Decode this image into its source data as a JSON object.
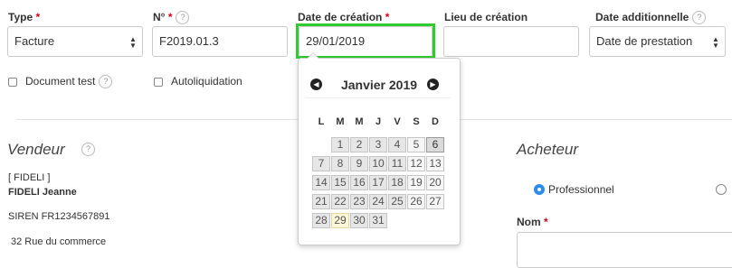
{
  "form": {
    "type": {
      "label": "Type",
      "required": "*",
      "value": "Facture"
    },
    "numero": {
      "label": "N°",
      "required": "*",
      "value": "F2019.01.3"
    },
    "date_creation": {
      "label": "Date de création",
      "required": "*",
      "value": "29/01/2019"
    },
    "lieu_creation": {
      "label": "Lieu de création",
      "value": ""
    },
    "date_additionnelle": {
      "label": "Date additionnelle",
      "value": "Date de prestation"
    },
    "document_test": {
      "label": "Document test",
      "checked": false
    },
    "autoliquidation": {
      "label": "Autoliquidation",
      "checked": false
    },
    "help_icon": "?"
  },
  "calendar": {
    "month_label": "Janvier 2019",
    "prev_icon": "◀",
    "next_icon": "▶",
    "weekdays": [
      "L",
      "M",
      "M",
      "J",
      "V",
      "S",
      "D"
    ],
    "weeks": [
      [
        "",
        "1",
        "2",
        "3",
        "4",
        "5",
        "6"
      ],
      [
        "7",
        "8",
        "9",
        "10",
        "11",
        "12",
        "13"
      ],
      [
        "14",
        "15",
        "16",
        "17",
        "18",
        "19",
        "20"
      ],
      [
        "21",
        "22",
        "23",
        "24",
        "25",
        "26",
        "27"
      ],
      [
        "28",
        "29",
        "30",
        "31",
        "",
        "",
        ""
      ]
    ],
    "selected_day": "29",
    "highlighted_day": "6"
  },
  "vendeur": {
    "title": "Vendeur",
    "lines": [
      "[ FIDELI ]",
      "FIDELI Jeanne",
      "SIREN FR1234567891",
      "32 Rue du commerce"
    ]
  },
  "acheteur": {
    "title": "Acheteur",
    "radio_professionnel": "Professionnel",
    "nom_label": "Nom",
    "nom_required": "*"
  },
  "colors": {
    "focus": "#2ecc2e",
    "required": "#d0021b",
    "radio_accent": "#2d8ceb"
  }
}
